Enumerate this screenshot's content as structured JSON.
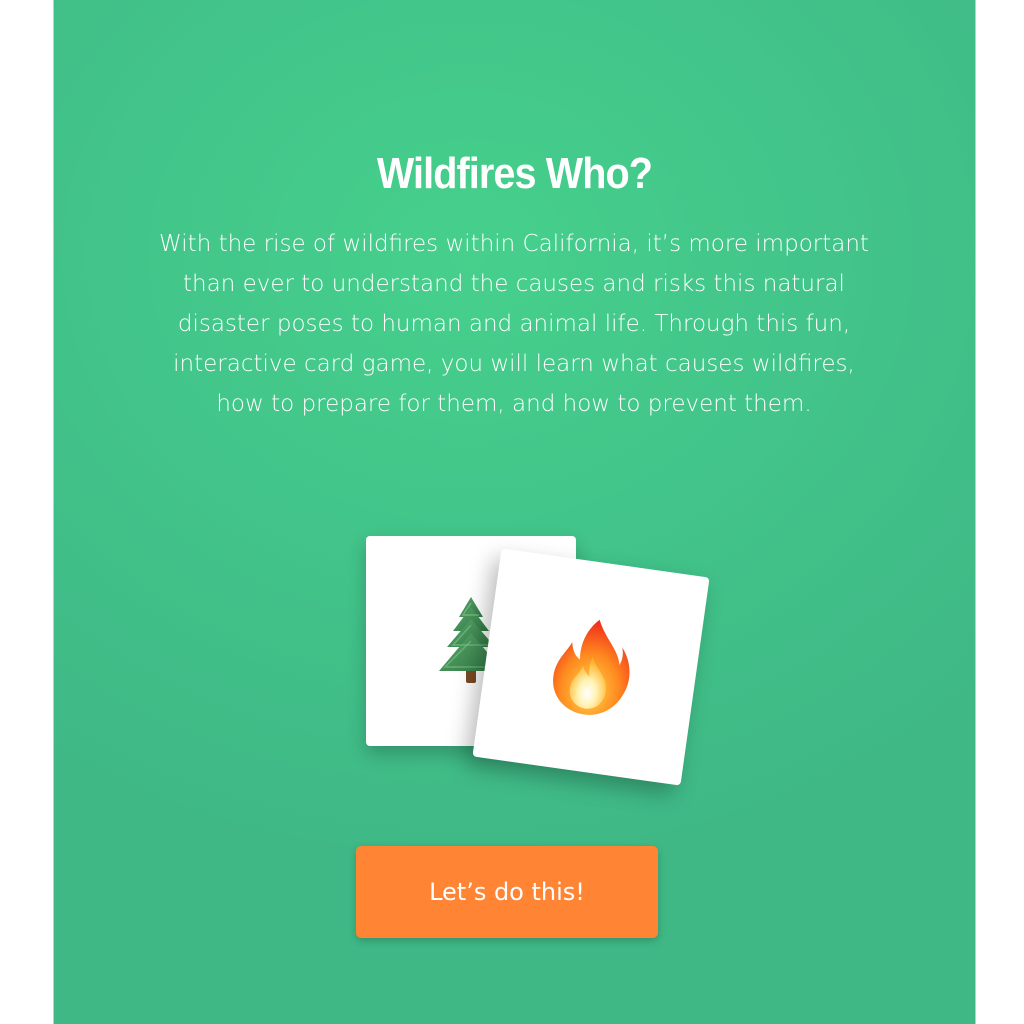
{
  "intro": {
    "title": "Wildfires Who?",
    "description": "With the rise of wildfires within California, it’s more important than ever to understand the causes and risks this natural disaster poses to human and animal life. Through this fun, interactive card game, you will learn what causes wildfires, how to prepare for them, and how to prevent them."
  },
  "cards": [
    {
      "icon": "evergreen-tree-icon"
    },
    {
      "icon": "fire-icon"
    }
  ],
  "cta": {
    "label": "Let’s do this!"
  },
  "colors": {
    "background": "#42c58a",
    "button": "#ff8534",
    "card": "#ffffff",
    "text": "#ffffff"
  }
}
